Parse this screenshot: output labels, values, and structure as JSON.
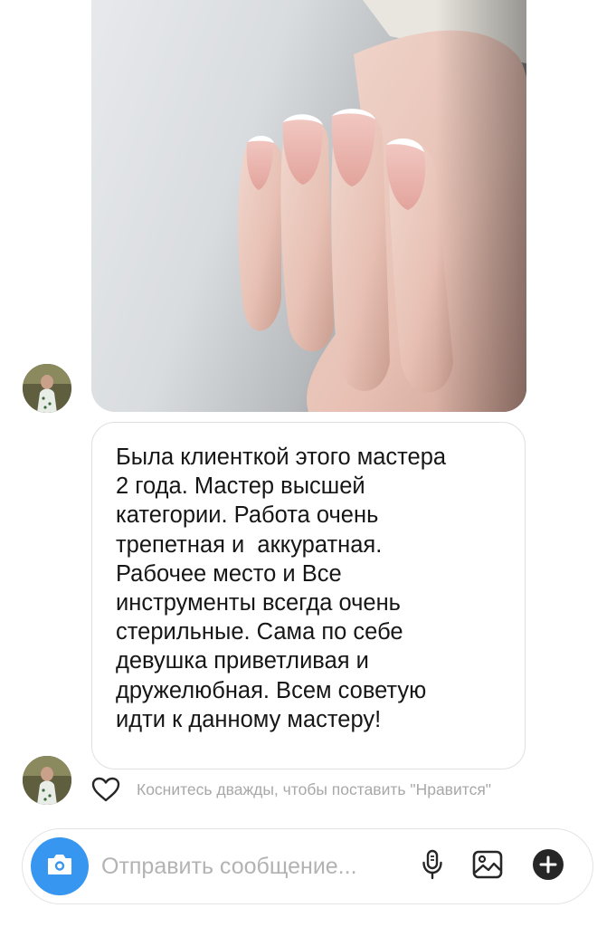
{
  "messages": [
    {
      "type": "photo",
      "icon": "photo-message-manicure"
    },
    {
      "type": "text",
      "text": "Была клиенткой этого мастера\n2 года. Мастер высшей\nкатегории. Работа очень\nтрепетная и  аккуратная.\nРабочее место и Все\nинструменты всегда очень\nстерильные. Сама по себе\nдевушка приветливая и\nдружелюбная. Всем советую\nидти к данному мастеру!"
    }
  ],
  "like_hint": {
    "icon": "heart-outline-icon",
    "text": "Коснитесь дважды, чтобы поставить \"Нравится\""
  },
  "composer": {
    "placeholder": "Отправить сообщение...",
    "value": "",
    "icons": [
      "camera-icon",
      "microphone-icon",
      "gallery-icon",
      "plus-circle-icon"
    ]
  },
  "colors": {
    "accent": "#3797f0",
    "bubble_border": "#e0e0e0",
    "hint_text": "#a8a8a8",
    "placeholder": "#b3b3b3"
  }
}
